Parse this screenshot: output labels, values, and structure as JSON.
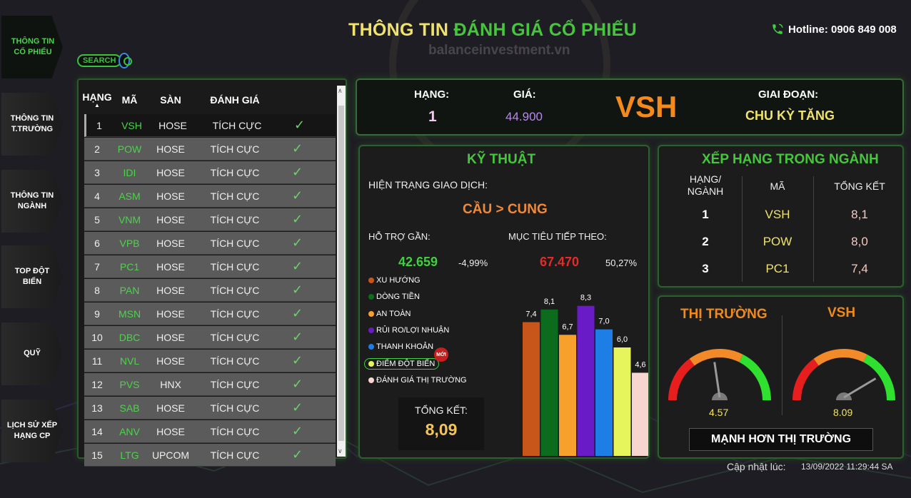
{
  "nav": [
    {
      "label": "THÔNG TIN CỔ PHIẾU",
      "active": true
    },
    {
      "label": "THÔNG TIN T.TRƯỜNG",
      "active": false
    },
    {
      "label": "THÔNG TIN NGÀNH",
      "active": false
    },
    {
      "label": "TOP ĐỘT BIẾN",
      "active": false
    },
    {
      "label": "QUỸ",
      "active": false
    },
    {
      "label": "LỊCH SỬ XẾP HẠNG CP",
      "active": false
    }
  ],
  "header": {
    "title_part1": "THÔNG TIN",
    "title_part2": "ĐÁNH GIÁ CỔ PHIẾU",
    "hotline": "Hotline: 0906 849 008",
    "watermark": "balanceinvestment.vn"
  },
  "search": {
    "label": "SEARCH"
  },
  "table": {
    "headers": [
      "HẠNG",
      "MÃ",
      "SÀN",
      "ĐÁNH GIÁ"
    ],
    "rows": [
      {
        "rank": "1",
        "code": "VSH",
        "exchange": "HOSE",
        "rating": "TÍCH CỰC"
      },
      {
        "rank": "2",
        "code": "POW",
        "exchange": "HOSE",
        "rating": "TÍCH CỰC"
      },
      {
        "rank": "3",
        "code": "IDI",
        "exchange": "HOSE",
        "rating": "TÍCH CỰC"
      },
      {
        "rank": "4",
        "code": "ASM",
        "exchange": "HOSE",
        "rating": "TÍCH CỰC"
      },
      {
        "rank": "5",
        "code": "VNM",
        "exchange": "HOSE",
        "rating": "TÍCH CỰC"
      },
      {
        "rank": "6",
        "code": "VPB",
        "exchange": "HOSE",
        "rating": "TÍCH CỰC"
      },
      {
        "rank": "7",
        "code": "PC1",
        "exchange": "HOSE",
        "rating": "TÍCH CỰC"
      },
      {
        "rank": "8",
        "code": "PAN",
        "exchange": "HOSE",
        "rating": "TÍCH CỰC"
      },
      {
        "rank": "9",
        "code": "MSN",
        "exchange": "HOSE",
        "rating": "TÍCH CỰC"
      },
      {
        "rank": "10",
        "code": "DBC",
        "exchange": "HOSE",
        "rating": "TÍCH CỰC"
      },
      {
        "rank": "11",
        "code": "NVL",
        "exchange": "HOSE",
        "rating": "TÍCH CỰC"
      },
      {
        "rank": "12",
        "code": "PVS",
        "exchange": "HNX",
        "rating": "TÍCH CỰC"
      },
      {
        "rank": "13",
        "code": "SAB",
        "exchange": "HOSE",
        "rating": "TÍCH CỰC"
      },
      {
        "rank": "14",
        "code": "ANV",
        "exchange": "HOSE",
        "rating": "TÍCH CỰC"
      },
      {
        "rank": "15",
        "code": "LTG",
        "exchange": "UPCOM",
        "rating": "TÍCH CỰC"
      }
    ]
  },
  "info": {
    "rank_label": "HẠNG:",
    "rank_value": "1",
    "price_label": "GIÁ:",
    "price_value": "44.900",
    "symbol": "VSH",
    "phase_label": "GIAI ĐOẠN:",
    "phase_value": "CHU KỲ TĂNG"
  },
  "technical": {
    "title": "KỸ THUẬT",
    "status_label": "HIỆN TRẠNG GIAO DỊCH:",
    "status_value": "CẦU > CUNG",
    "support_label": "HỖ TRỢ GẦN:",
    "support_value": "42.659",
    "support_pct": "-4,99%",
    "target_label": "MỤC TIÊU TIẾP THEO:",
    "target_value": "67.470",
    "target_pct": "50,27%",
    "total_label": "TỔNG KẾT:",
    "total_value": "8,09",
    "new_badge": "MỚI",
    "legend": [
      {
        "label": "XU HƯỚNG",
        "color": "#c8561a"
      },
      {
        "label": "DÒNG TIỀN",
        "color": "#0d6b1e"
      },
      {
        "label": "AN TOÀN",
        "color": "#f7a02b"
      },
      {
        "label": "RỦI RO/LỢI NHUẬN",
        "color": "#6a1bc8"
      },
      {
        "label": "THANH KHOẢN",
        "color": "#1d7fe6"
      },
      {
        "label": "ĐIỂM ĐỘT BIẾN",
        "color": "#e6f55c"
      },
      {
        "label": "ĐÁNH GIÁ THỊ TRƯỜNG",
        "color": "#f7d6d2"
      }
    ]
  },
  "chart_data": {
    "type": "bar",
    "categories": [
      "XU HƯỚNG",
      "DÒNG TIỀN",
      "AN TOÀN",
      "RỦI RO/LỢI NHUẬN",
      "THANH KHOẢN",
      "ĐIỂM ĐỘT BIẾN",
      "ĐÁNH GIÁ THỊ TRƯỜNG"
    ],
    "values": [
      7.4,
      8.1,
      6.7,
      8.3,
      7.0,
      6.0,
      4.6
    ],
    "value_labels": [
      "7,4",
      "8,1",
      "6,7",
      "8,3",
      "7,0",
      "6,0",
      "4,6"
    ],
    "colors": [
      "#c8561a",
      "#0d6b1e",
      "#f7a02b",
      "#6a1bc8",
      "#1d7fe6",
      "#e6f55c",
      "#f7d6d2"
    ],
    "ylim": [
      0,
      9
    ]
  },
  "ranking": {
    "title": "XẾP HẠNG TRONG NGÀNH",
    "headers": [
      "HẠNG/ NGÀNH",
      "MÃ",
      "TỔNG KẾT"
    ],
    "rows": [
      {
        "rank": "1",
        "code": "VSH",
        "total": "8,1"
      },
      {
        "rank": "2",
        "code": "POW",
        "total": "8,0"
      },
      {
        "rank": "3",
        "code": "PC1",
        "total": "7,4"
      }
    ]
  },
  "market": {
    "left_title": "THỊ TRƯỜNG",
    "right_title": "VSH",
    "gauge_left": {
      "label": "4.57",
      "value": 4.57
    },
    "gauge_right": {
      "label": "8.09",
      "value": 8.09
    },
    "gauge_max": 10,
    "verdict": "MẠNH HƠN THỊ TRƯỜNG"
  },
  "footer": {
    "updated_label": "Cập nhật lúc:",
    "updated_value": "13/09/2022 11:29:44 SA"
  }
}
